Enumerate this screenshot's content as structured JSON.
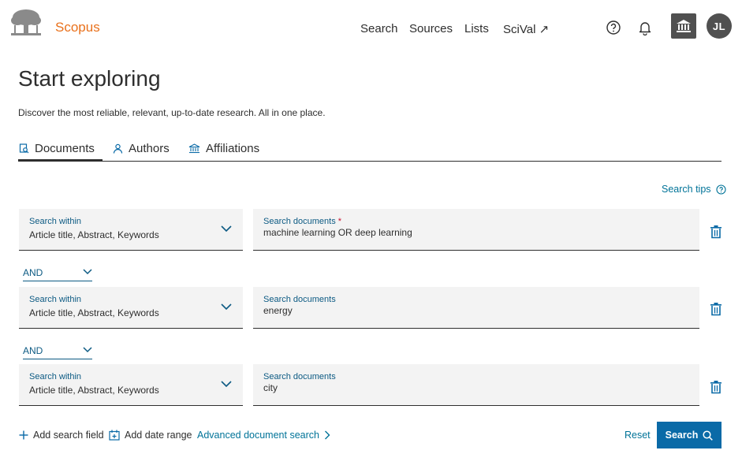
{
  "header": {
    "brand": "Scopus",
    "nav": [
      "Search",
      "Sources",
      "Lists",
      "SciVal ↗"
    ],
    "avatar_initials": "JL",
    "icons": [
      "help-icon",
      "bell-icon",
      "institution-icon"
    ]
  },
  "hero": {
    "title": "Start exploring",
    "subtitle": "Discover the most reliable, relevant, up-to-date research. All in one place."
  },
  "tabs": [
    {
      "label": "Documents",
      "icon": "document-search-icon",
      "active": true
    },
    {
      "label": "Authors",
      "icon": "person-icon",
      "active": false
    },
    {
      "label": "Affiliations",
      "icon": "institution-icon",
      "active": false
    }
  ],
  "search_tips": "Search tips",
  "rows": [
    {
      "within_label": "Search within",
      "within_value": "Article title, Abstract, Keywords",
      "docs_label": "Search documents",
      "docs_required": "*",
      "docs_value": "machine learning OR deep learning"
    },
    {
      "operator": "AND",
      "within_label": "Search within",
      "within_value": "Article title, Abstract, Keywords",
      "docs_label": "Search documents",
      "docs_value": "energy"
    },
    {
      "operator": "AND",
      "within_label": "Search within",
      "within_value": "Article title, Abstract, Keywords",
      "docs_label": "Search documents",
      "docs_value": "city"
    }
  ],
  "footer": {
    "add_field": "Add search field",
    "add_date": "Add date range",
    "advanced": "Advanced document search",
    "reset": "Reset",
    "search": "Search"
  },
  "colors": {
    "accent": "#007398",
    "brand": "#e9711c",
    "button": "#0a6aa7",
    "field_bg": "#f3f3f3"
  }
}
